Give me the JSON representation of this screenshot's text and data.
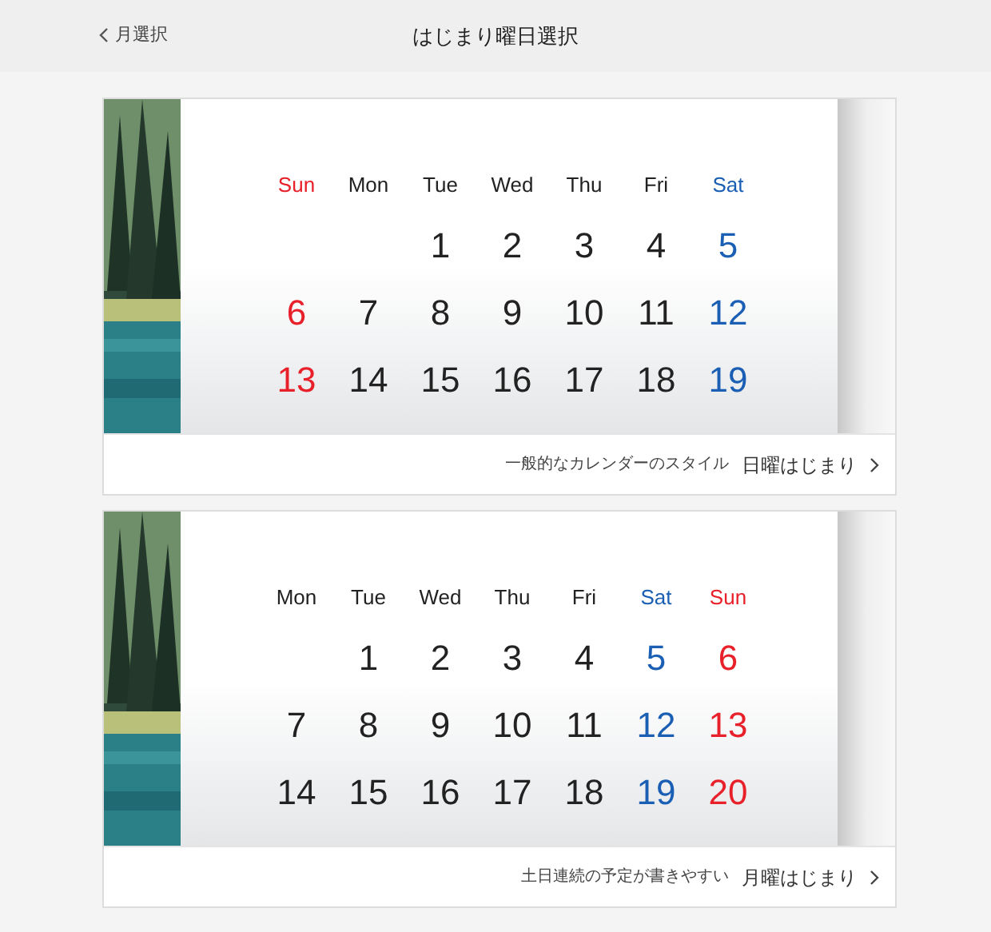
{
  "header": {
    "back_label": "月選択",
    "title": "はじまり曜日選択"
  },
  "cards": [
    {
      "weekdays": [
        {
          "label": "Sun",
          "color": "#e8202a"
        },
        {
          "label": "Mon",
          "color": "#222222"
        },
        {
          "label": "Tue",
          "color": "#222222"
        },
        {
          "label": "Wed",
          "color": "#222222"
        },
        {
          "label": "Thu",
          "color": "#222222"
        },
        {
          "label": "Fri",
          "color": "#222222"
        },
        {
          "label": "Sat",
          "color": "#1a5fb4"
        }
      ],
      "weeks": [
        [
          "1",
          "2",
          "3",
          "4",
          "5"
        ],
        [
          "6",
          "7",
          "8",
          "9",
          "10",
          "11",
          "12"
        ],
        [
          "13",
          "14",
          "15",
          "16",
          "17",
          "18",
          "19"
        ]
      ],
      "description": "一般的なカレンダーのスタイル",
      "title": "日曜はじまり"
    },
    {
      "weekdays": [
        {
          "label": "Mon",
          "color": "#222222"
        },
        {
          "label": "Tue",
          "color": "#222222"
        },
        {
          "label": "Wed",
          "color": "#222222"
        },
        {
          "label": "Thu",
          "color": "#222222"
        },
        {
          "label": "Fri",
          "color": "#222222"
        },
        {
          "label": "Sat",
          "color": "#1a5fb4"
        },
        {
          "label": "Sun",
          "color": "#e8202a"
        }
      ],
      "weeks": [
        [
          "1",
          "2",
          "3",
          "4",
          "5",
          "6"
        ],
        [
          "7",
          "8",
          "9",
          "10",
          "11",
          "12",
          "13"
        ],
        [
          "14",
          "15",
          "16",
          "17",
          "18",
          "19",
          "20"
        ]
      ],
      "description": "土日連続の予定が書きやすい",
      "title": "月曜はじまり"
    }
  ]
}
